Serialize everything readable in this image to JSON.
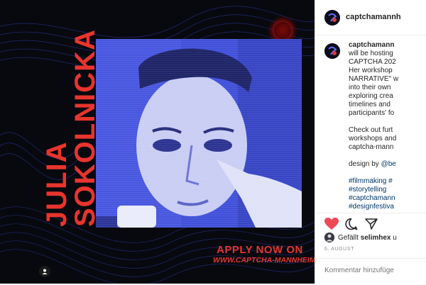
{
  "post": {
    "name_line1": "JULIA",
    "name_line2": "SOKOLNICKA",
    "apply_text": "APPLY NOW ON",
    "apply_url": "WWW.CAPTCHA-MANNHEIM.DE"
  },
  "sidebar": {
    "header_username": "captchamannh",
    "caption_username": "captchamann",
    "caption_lines": [
      "will be hosting",
      "CAPTCHA 202",
      "Her workshop",
      "NARRATIVE\" w",
      "into their own",
      "exploring crea",
      "timelines and",
      "participants' fo"
    ],
    "caption_more": [
      "Check out furt",
      "workshops and",
      "captcha-mann"
    ],
    "design_by": "design by",
    "design_handle": "@be",
    "hashtags": [
      "#filmmaking #",
      "#storytelling",
      "#captchamann",
      "#designfestiva"
    ],
    "liked_by_prefix": "Gefällt",
    "liked_by_user": "selimhex",
    "liked_by_suffix": "u",
    "date": "6. AUGUST",
    "comment_placeholder": "Kommentar hinzufüge"
  },
  "icons": {
    "like": "heart-icon",
    "comment": "comment-icon",
    "share": "share-icon",
    "tag": "user-tag-icon"
  },
  "colors": {
    "accent_red": "#e8342e",
    "like_red": "#ed4956",
    "photo_blue": "#3f4fd9",
    "hashtag_blue": "#00376b"
  }
}
